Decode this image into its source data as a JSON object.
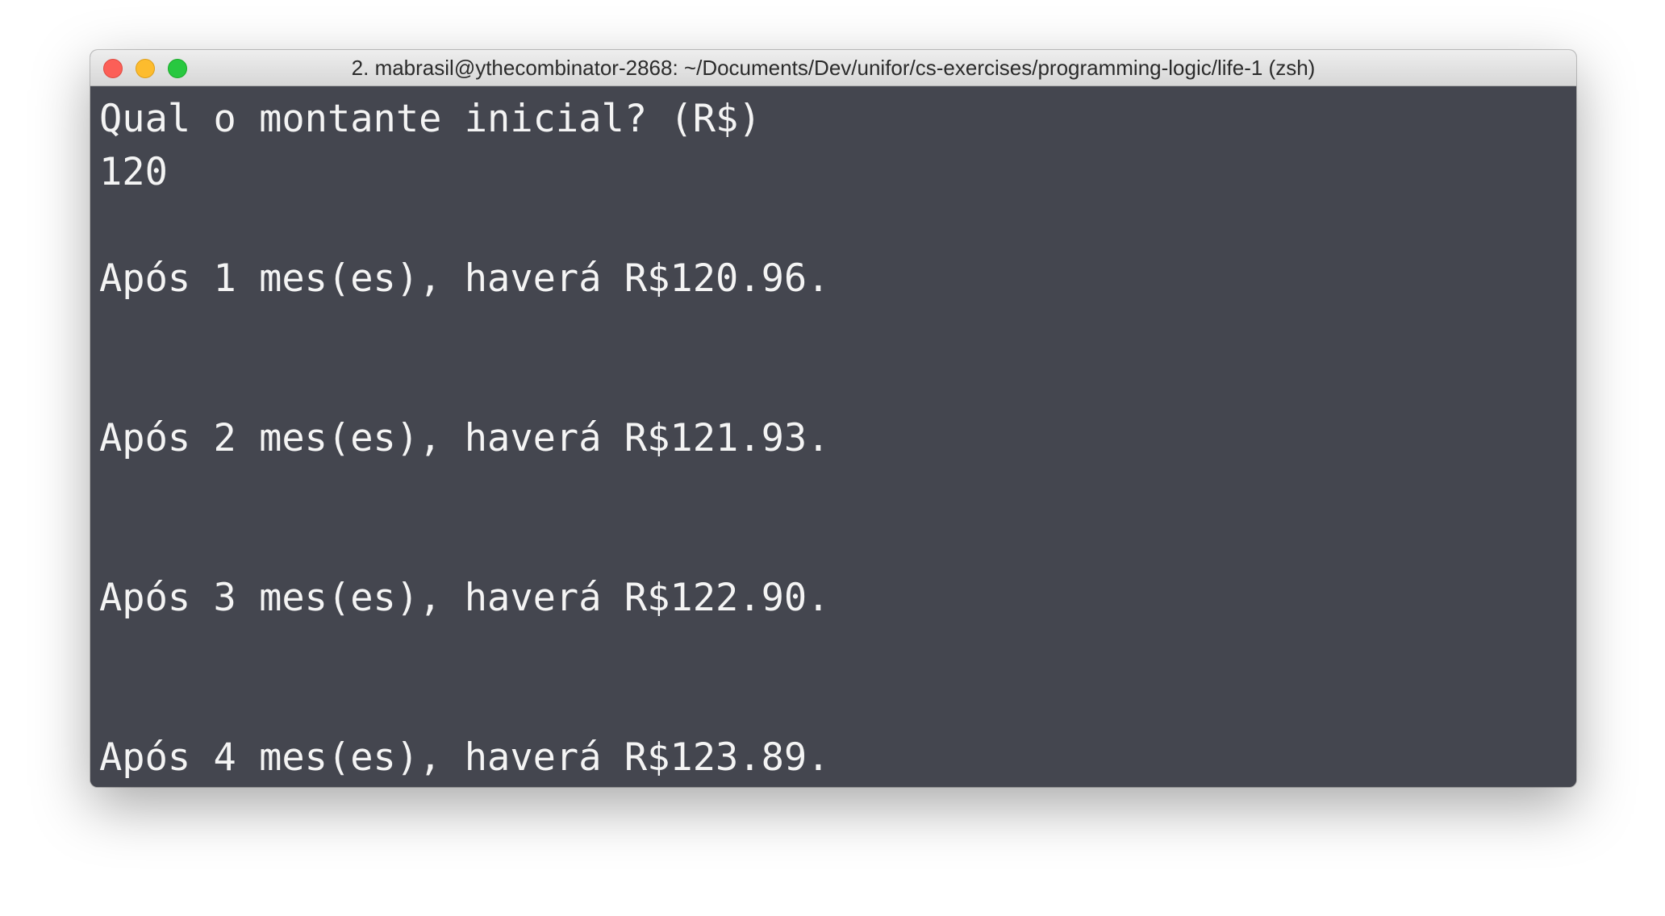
{
  "window": {
    "title": "2. mabrasil@ythecombinator-2868: ~/Documents/Dev/unifor/cs-exercises/programming-logic/life-1 (zsh)",
    "controls": {
      "close_color": "#fc5f57",
      "minimize_color": "#fdbc2e",
      "zoom_color": "#28c840"
    }
  },
  "terminal": {
    "background_color": "#44464f",
    "text_color": "#f4f4f4",
    "lines": [
      "Qual o montante inicial? (R$)",
      "120",
      "",
      "Após 1 mes(es), haverá R$120.96.",
      "",
      "",
      "Após 2 mes(es), haverá R$121.93.",
      "",
      "",
      "Após 3 mes(es), haverá R$122.90.",
      "",
      "",
      "Após 4 mes(es), haverá R$123.89."
    ]
  }
}
